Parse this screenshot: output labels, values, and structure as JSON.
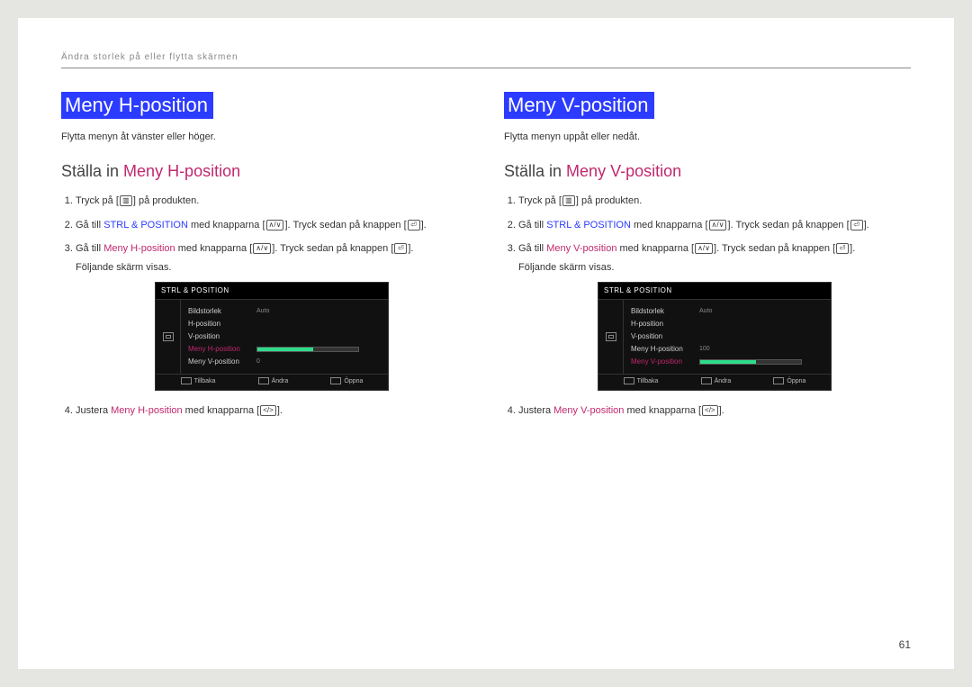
{
  "breadcrumb": "Ändra storlek på eller flytta skärmen",
  "page_number": "61",
  "left": {
    "title": "Meny H-position",
    "desc": "Flytta menyn åt vänster eller höger.",
    "subhead_prefix": "Ställa in ",
    "subhead_accent": "Meny H-position",
    "step1_a": "Tryck på [",
    "step1_b": "] på produkten.",
    "step2_a": "Gå till ",
    "step2_hl": "STRL & POSITION",
    "step2_b": " med knapparna [",
    "step2_c": "]. Tryck sedan på knappen [",
    "step2_d": "].",
    "step3_a": "Gå till ",
    "step3_hl": "Meny H-position",
    "step3_b": " med knapparna [",
    "step3_c": "]. Tryck sedan på knappen [",
    "step3_d": "].",
    "step3_e": "Följande skärm visas.",
    "step4_a": "Justera ",
    "step4_hl": "Meny H-position",
    "step4_b": " med knapparna [",
    "step4_c": "]."
  },
  "right": {
    "title": "Meny V-position",
    "desc": "Flytta menyn uppåt eller nedåt.",
    "subhead_prefix": "Ställa in ",
    "subhead_accent": "Meny V-position",
    "step1_a": "Tryck på [",
    "step1_b": "] på produkten.",
    "step2_a": "Gå till ",
    "step2_hl": "STRL & POSITION",
    "step2_b": " med knapparna [",
    "step2_c": "]. Tryck sedan på knappen [",
    "step2_d": "].",
    "step3_a": "Gå till ",
    "step3_hl": "Meny V-position",
    "step3_b": " med knapparna [",
    "step3_c": "]. Tryck sedan på knappen [",
    "step3_d": "].",
    "step3_e": "Följande skärm visas.",
    "step4_a": "Justera ",
    "step4_hl": "Meny V-position",
    "step4_b": " med knapparna [",
    "step4_c": "]."
  },
  "icons": {
    "menu": "▥",
    "updown": "∧/∨",
    "enter": "⏎",
    "leftright": "</>"
  },
  "osd": {
    "title": "STRL & POSITION",
    "rows": {
      "r0_label": "Bildstorlek",
      "r0_val": "Auto",
      "r1_label": "H-position",
      "r2_label": "V-position",
      "r3_label_left": "Meny H-position",
      "r3_label_right": "Meny H-position",
      "r3_val_right": "100",
      "r4_label_left": "Meny V-position",
      "r4_val_left": "0",
      "r4_label_right": "Meny V-position"
    },
    "footer": {
      "f0": "Tillbaka",
      "f1": "Ändra",
      "f2": "Öppna"
    }
  }
}
